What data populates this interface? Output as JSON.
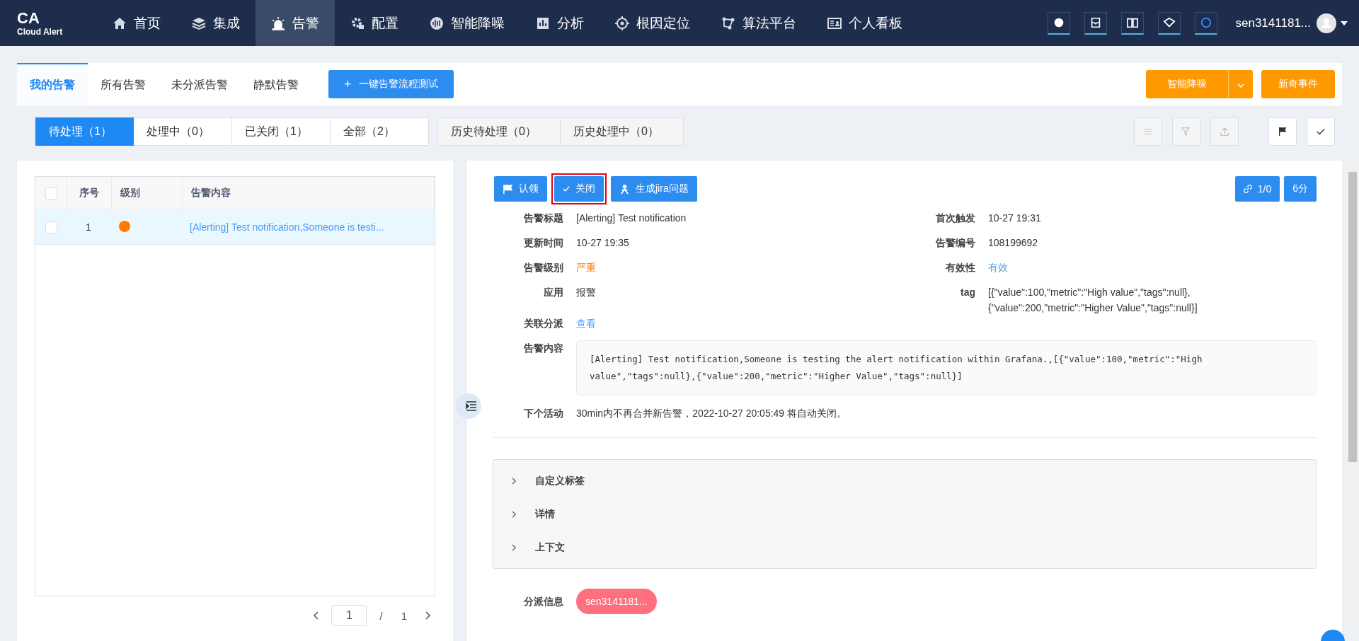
{
  "logo": {
    "title": "CA",
    "subtitle": "Cloud Alert"
  },
  "nav": [
    {
      "label": "首页",
      "selected": false
    },
    {
      "label": "集成",
      "selected": false
    },
    {
      "label": "告警",
      "selected": true
    },
    {
      "label": "配置",
      "selected": false
    },
    {
      "label": "智能降噪",
      "selected": false
    },
    {
      "label": "分析",
      "selected": false
    },
    {
      "label": "根因定位",
      "selected": false
    },
    {
      "label": "算法平台",
      "selected": false
    },
    {
      "label": "个人看板",
      "selected": false
    }
  ],
  "user": {
    "name": "sen3141181..."
  },
  "tabs": [
    {
      "label": "我的告警",
      "selected": true
    },
    {
      "label": "所有告警",
      "selected": false
    },
    {
      "label": "未分派告警",
      "selected": false
    },
    {
      "label": "静默告警",
      "selected": false
    }
  ],
  "test_button": {
    "icon": "+",
    "label": "一键告警流程测试"
  },
  "noise_button": {
    "label": "智能降噪"
  },
  "novel_button": {
    "label": "新奇事件"
  },
  "filters": [
    {
      "label": "待处理（1）",
      "selected": true
    },
    {
      "label": "处理中（0）",
      "selected": false
    },
    {
      "label": "已关闭（1）",
      "selected": false
    },
    {
      "label": "全部（2）",
      "selected": false
    }
  ],
  "history_filters": [
    {
      "label": "历史待处理（0）",
      "selected": false
    },
    {
      "label": "历史处理中（0）",
      "selected": false
    }
  ],
  "tools": [
    {
      "disabled": true
    },
    {
      "disabled": true
    },
    {
      "disabled": true
    },
    {
      "disabled": false
    },
    {
      "disabled": false
    }
  ],
  "table": {
    "select_all_checked": false,
    "columns": [
      "序号",
      "级别",
      "告警内容"
    ],
    "rows": [
      {
        "checked": false,
        "selected": true,
        "index": "1",
        "color": "#ff7a00",
        "content": "[Alerting] Test notification,Someone is testi..."
      }
    ]
  },
  "pagination": {
    "page": "1",
    "separator": "/",
    "total": "1"
  },
  "actions": [
    {
      "label": "认领",
      "highlighted": false
    },
    {
      "label": "关闭",
      "highlighted": true
    },
    {
      "label": "生成jira问题",
      "highlighted": false
    }
  ],
  "link_count": "1/0",
  "duration": "6分",
  "fields_left": [
    {
      "label": "告警标题",
      "value": "[Alerting] Test notification",
      "color": "#333333"
    },
    {
      "label": "更新时间",
      "value": "10-27 19:35",
      "color": "#333333"
    },
    {
      "label": "告警级别",
      "value": "严重",
      "color": "#ff7a00"
    },
    {
      "label": "应用",
      "value": "报警",
      "color": "#333333"
    }
  ],
  "fields_right": [
    {
      "label": "首次触发",
      "value": "10-27 19:31",
      "color": "#333333"
    },
    {
      "label": "告警编号",
      "value": "108199692",
      "color": "#333333"
    },
    {
      "label": "有效性",
      "value": "有效",
      "color": "#4a9cf3"
    },
    {
      "label": "tag",
      "value": "[{\"value\":100,\"metric\":\"High value\",\"tags\":null},\n{\"value\":200,\"metric\":\"Higher Value\",\"tags\":null}]",
      "color": "#333333"
    }
  ],
  "assign": {
    "label": "关联分派",
    "value": "查看"
  },
  "content": {
    "label": "告警内容",
    "value": "[Alerting] Test notification,Someone is testing the alert notification within Grafana.,[{\"value\":100,\"metric\":\"High value\",\"tags\":null},{\"value\":200,\"metric\":\"Higher Value\",\"tags\":null}]"
  },
  "next": {
    "label": "下个活动",
    "value": "30min内不再合并新告警，2022-10-27 20:05:49 将自动关闭。"
  },
  "sections": [
    {
      "label": "自定义标签",
      "expanded": false
    },
    {
      "label": "详情",
      "expanded": false
    },
    {
      "label": "上下文",
      "expanded": false
    }
  ],
  "dispatch": {
    "label": "分派信息",
    "value": "sen3141181..."
  }
}
